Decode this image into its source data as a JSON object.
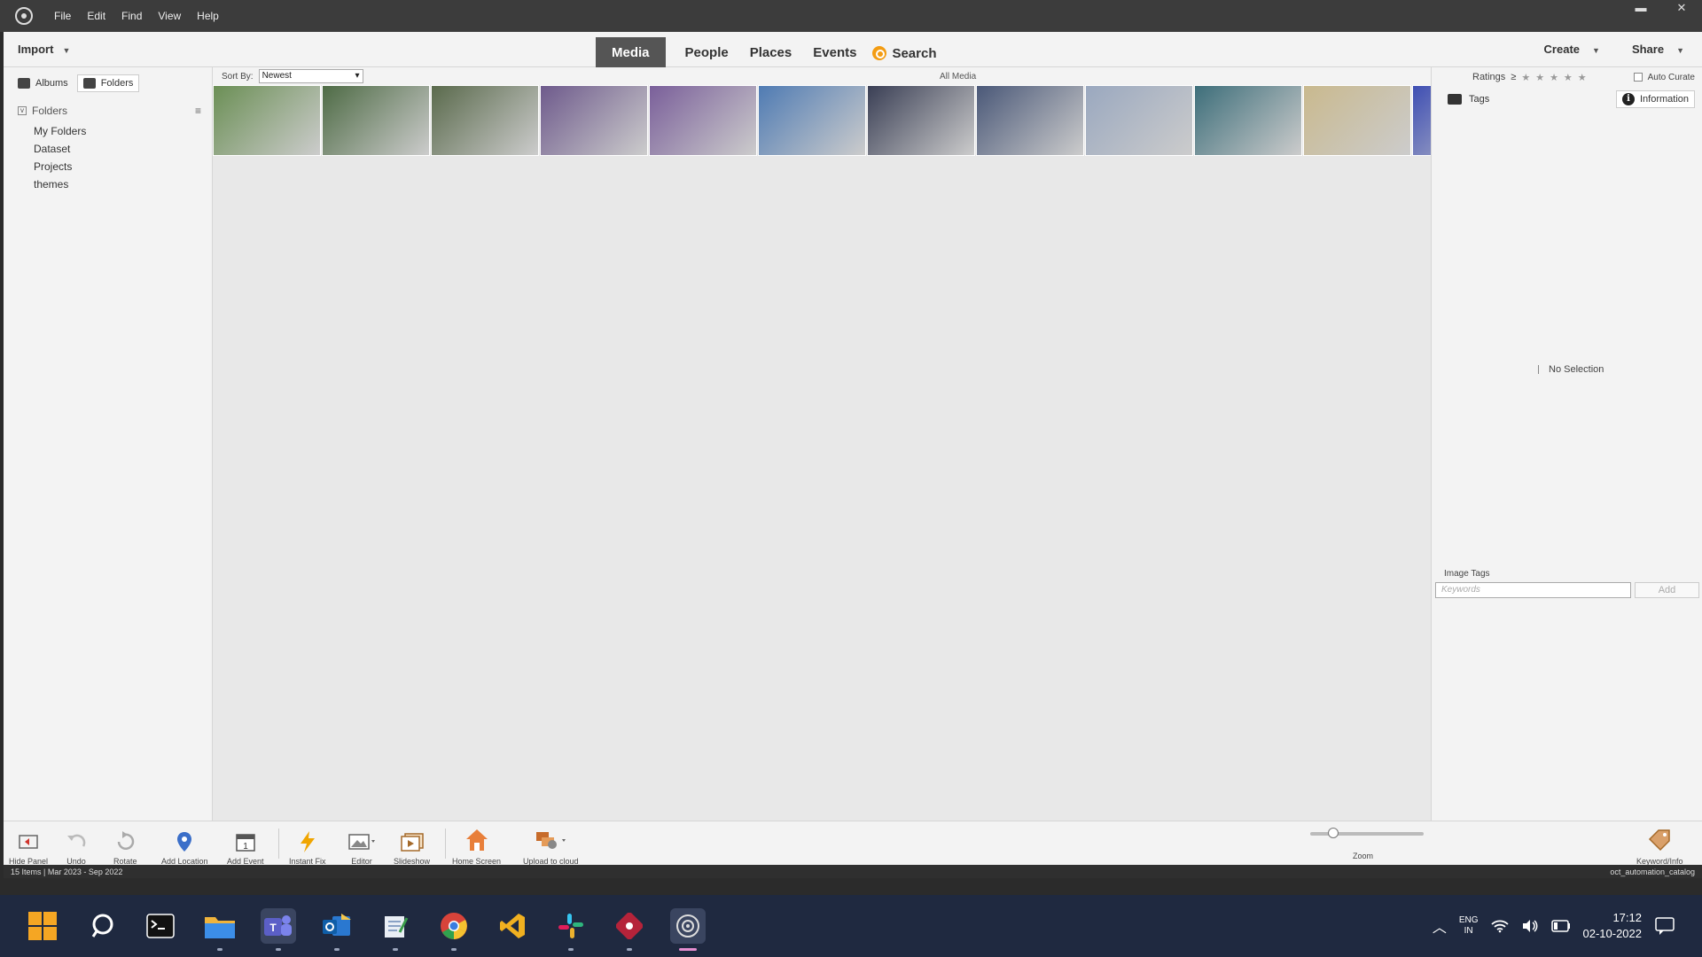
{
  "menu": [
    "File",
    "Edit",
    "Find",
    "View",
    "Help"
  ],
  "window": {
    "minimize": "▬",
    "close": "✕"
  },
  "topnav": {
    "import": "Import",
    "tabs": [
      "Media",
      "People",
      "Places",
      "Events"
    ],
    "search": "Search",
    "create": "Create",
    "share": "Share"
  },
  "left_panel": {
    "albums_tab": "Albums",
    "folders_tab": "Folders",
    "folders_header": "Folders",
    "folders": [
      "My Folders",
      "Dataset",
      "Projects",
      "themes"
    ]
  },
  "grid": {
    "sort_by": "Sort By:",
    "sort_value": "Newest",
    "all_media": "All Media",
    "thumbs": [
      "#6b8f55",
      "#4e6b45",
      "#5a6a4c",
      "#6e5a8c",
      "#7a5f9a",
      "#4f7bb3",
      "#3a3f55",
      "#4a5878",
      "#9aa8bf",
      "#3d6e7a",
      "#c9b98e",
      "#3f4fb3"
    ]
  },
  "right_panel": {
    "ratings": "Ratings",
    "ratings_op": "≥",
    "stars": "★★★★★",
    "auto_curate": "Auto Curate",
    "tags_tab": "Tags",
    "information_tab": "Information",
    "no_selection": "No Selection",
    "image_tags": "Image Tags",
    "keywords_placeholder": "Keywords",
    "add": "Add"
  },
  "bottom_bar": {
    "hide_panel": "Hide Panel",
    "undo": "Undo",
    "rotate": "Rotate",
    "add_location": "Add Location",
    "add_event": "Add Event",
    "instant_fix": "Instant Fix",
    "editor": "Editor",
    "slideshow": "Slideshow",
    "home_screen": "Home Screen",
    "upload_to_cloud": "Upload to cloud",
    "zoom": "Zoom",
    "keywords_info": "Keyword/Info"
  },
  "status_bar": {
    "left": "15 Items | Mar 2023 - Sep 2022",
    "right": "oct_automation_catalog"
  },
  "taskbar": {
    "lang_top": "ENG",
    "lang_bottom": "IN",
    "time": "17:12",
    "date": "02-10-2022"
  }
}
